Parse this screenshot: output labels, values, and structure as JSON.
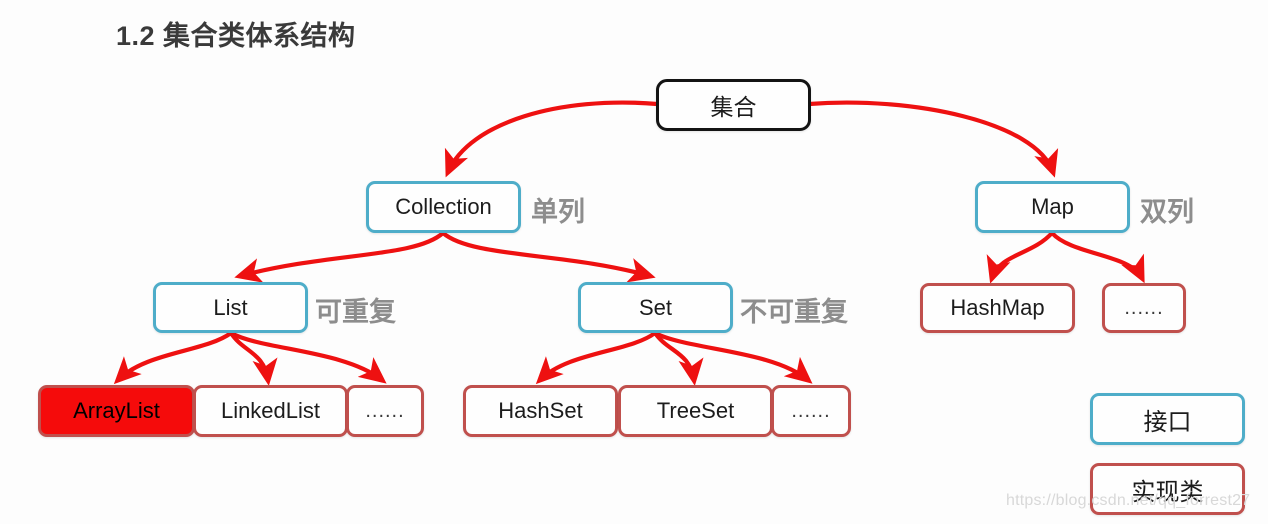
{
  "page": {
    "title": "1.2 集合类体系结构",
    "watermark": "https://blog.csdn.net/qq_forrest27"
  },
  "diagram": {
    "type": "hierarchy-tree",
    "edge_color": "#ee1111",
    "nodes": {
      "root": {
        "label": "集合",
        "kind": "root"
      },
      "collection": {
        "label": "Collection",
        "kind": "interface"
      },
      "map": {
        "label": "Map",
        "kind": "interface"
      },
      "list": {
        "label": "List",
        "kind": "interface"
      },
      "set": {
        "label": "Set",
        "kind": "interface"
      },
      "hashmap": {
        "label": "HashMap",
        "kind": "implementation"
      },
      "map_more": {
        "label": "......",
        "kind": "implementation"
      },
      "arraylist": {
        "label": "ArrayList",
        "kind": "implementation-highlighted"
      },
      "linkedlist": {
        "label": "LinkedList",
        "kind": "implementation"
      },
      "list_more": {
        "label": "......",
        "kind": "implementation"
      },
      "hashset": {
        "label": "HashSet",
        "kind": "implementation"
      },
      "treeset": {
        "label": "TreeSet",
        "kind": "implementation"
      },
      "set_more": {
        "label": "......",
        "kind": "implementation"
      }
    },
    "annotations": {
      "collection_note": "单列",
      "map_note": "双列",
      "list_note": "可重复",
      "set_note": "不可重复"
    }
  },
  "legend": {
    "interface": {
      "label": "接口",
      "color": "#4eadc9"
    },
    "implementation": {
      "label": "实现类",
      "color": "#c0504d"
    }
  },
  "colors": {
    "interface_border": "#4eadc9",
    "implementation_border": "#c0504d",
    "root_border": "#141414",
    "highlight_fill": "#f50b0b",
    "arrow": "#ee1111",
    "note_text": "#8d8d8d",
    "title_text": "#3a3a3a"
  }
}
